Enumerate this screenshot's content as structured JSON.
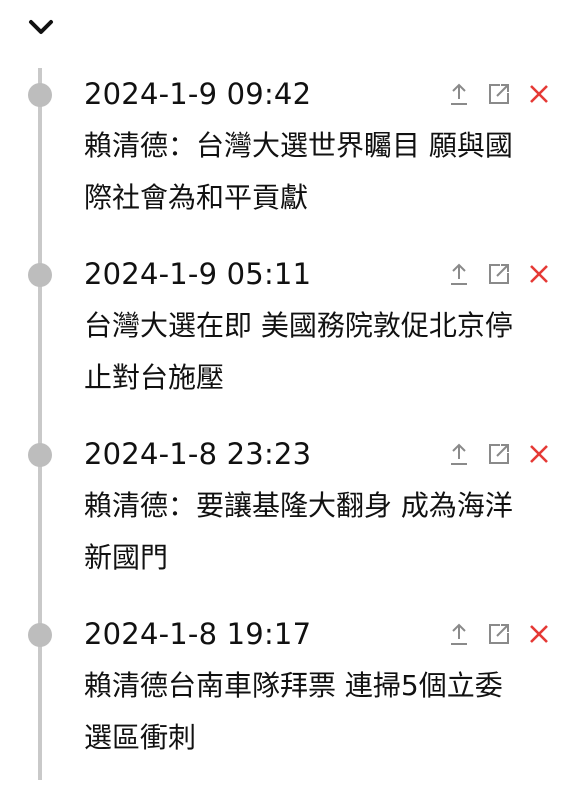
{
  "toggle": {
    "icon": "chevron-down-icon"
  },
  "entries": [
    {
      "time": "2024-1-9 09:42",
      "title": "賴清德：台灣大選世界矚目 願與國際社會為和平貢獻"
    },
    {
      "time": "2024-1-9 05:11",
      "title": "台灣大選在即 美國務院敦促北京停止對台施壓"
    },
    {
      "time": "2024-1-8 23:23",
      "title": "賴清德：要讓基隆大翻身 成為海洋新國門"
    },
    {
      "time": "2024-1-8 19:17",
      "title": "賴清德台南車隊拜票 連掃5個立委選區衝刺"
    }
  ],
  "actions": {
    "share_icon": "share-icon",
    "open_icon": "open-external-icon",
    "remove_icon": "close-icon"
  },
  "colors": {
    "line": "#c9c9c9",
    "dot": "#bdbdbd",
    "icon_gray": "#8a8a8a",
    "remove_red": "#e53935",
    "text": "#111111"
  }
}
